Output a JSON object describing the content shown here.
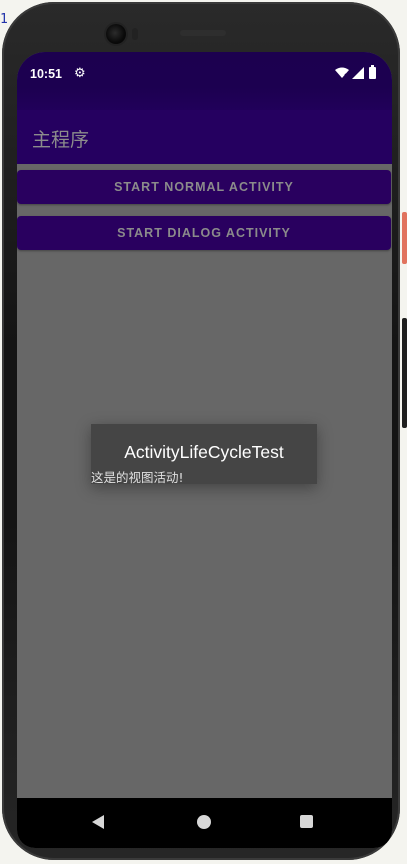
{
  "stray_text": "1",
  "status_bar": {
    "time": "10:51",
    "icons": [
      "settings-icon",
      "wifi-icon",
      "signal-icon",
      "battery-icon"
    ]
  },
  "app_bar": {
    "title": "主程序"
  },
  "buttons": {
    "start_normal": "START NORMAL ACTIVITY",
    "start_dialog": "START DIALOG ACTIVITY"
  },
  "dialog": {
    "title": "ActivityLifeCycleTest",
    "body": "这是的视图活动!"
  },
  "nav_bar": {
    "items": [
      "back",
      "home",
      "recents"
    ]
  },
  "colors": {
    "status_bar": "#1c004f",
    "app_bar": "#250060",
    "button": "#29005f",
    "content_background": "#676767",
    "dialog_background": "#454545"
  }
}
